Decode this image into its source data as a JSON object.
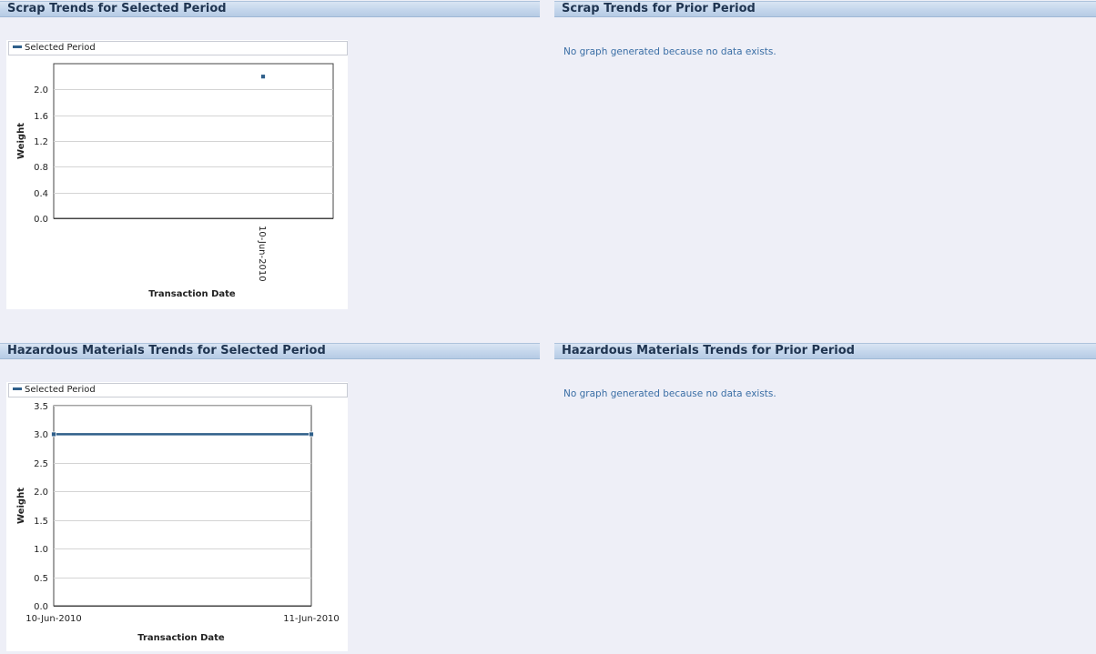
{
  "sections": {
    "scrap_selected": {
      "title": "Scrap Trends for Selected Period"
    },
    "scrap_prior": {
      "title": "Scrap Trends for Prior Period",
      "message": "No graph generated because no data exists."
    },
    "haz_selected": {
      "title": "Hazardous Materials Trends for Selected Period"
    },
    "haz_prior": {
      "title": "Hazardous Materials Trends for Prior Period",
      "message": "No graph generated because no data exists."
    }
  },
  "colors": {
    "series": "#2f5f8a",
    "header_text": "#1f3450",
    "message_text": "#3a6ea5"
  },
  "chart_data": [
    {
      "type": "line",
      "legend": "Selected Period",
      "xlabel": "Transaction Date",
      "ylabel": "Weight",
      "categories": [
        "10-Jun-2010"
      ],
      "series": [
        {
          "name": "Selected Period",
          "values": [
            2.2
          ]
        }
      ],
      "ylim": [
        0,
        2.4
      ],
      "yticks": [
        "0.0",
        "0.4",
        "0.8",
        "1.2",
        "1.6",
        "2.0"
      ],
      "grid": true,
      "legend_position": "top"
    },
    {
      "type": "line",
      "legend": "Selected Period",
      "xlabel": "Transaction Date",
      "ylabel": "Weight",
      "categories": [
        "10-Jun-2010",
        "11-Jun-2010"
      ],
      "series": [
        {
          "name": "Selected Period",
          "values": [
            3.0,
            3.0
          ]
        }
      ],
      "ylim": [
        0,
        3.5
      ],
      "yticks": [
        "0.0",
        "0.5",
        "1.0",
        "1.5",
        "2.0",
        "2.5",
        "3.0",
        "3.5"
      ],
      "grid": true,
      "legend_position": "top"
    }
  ]
}
